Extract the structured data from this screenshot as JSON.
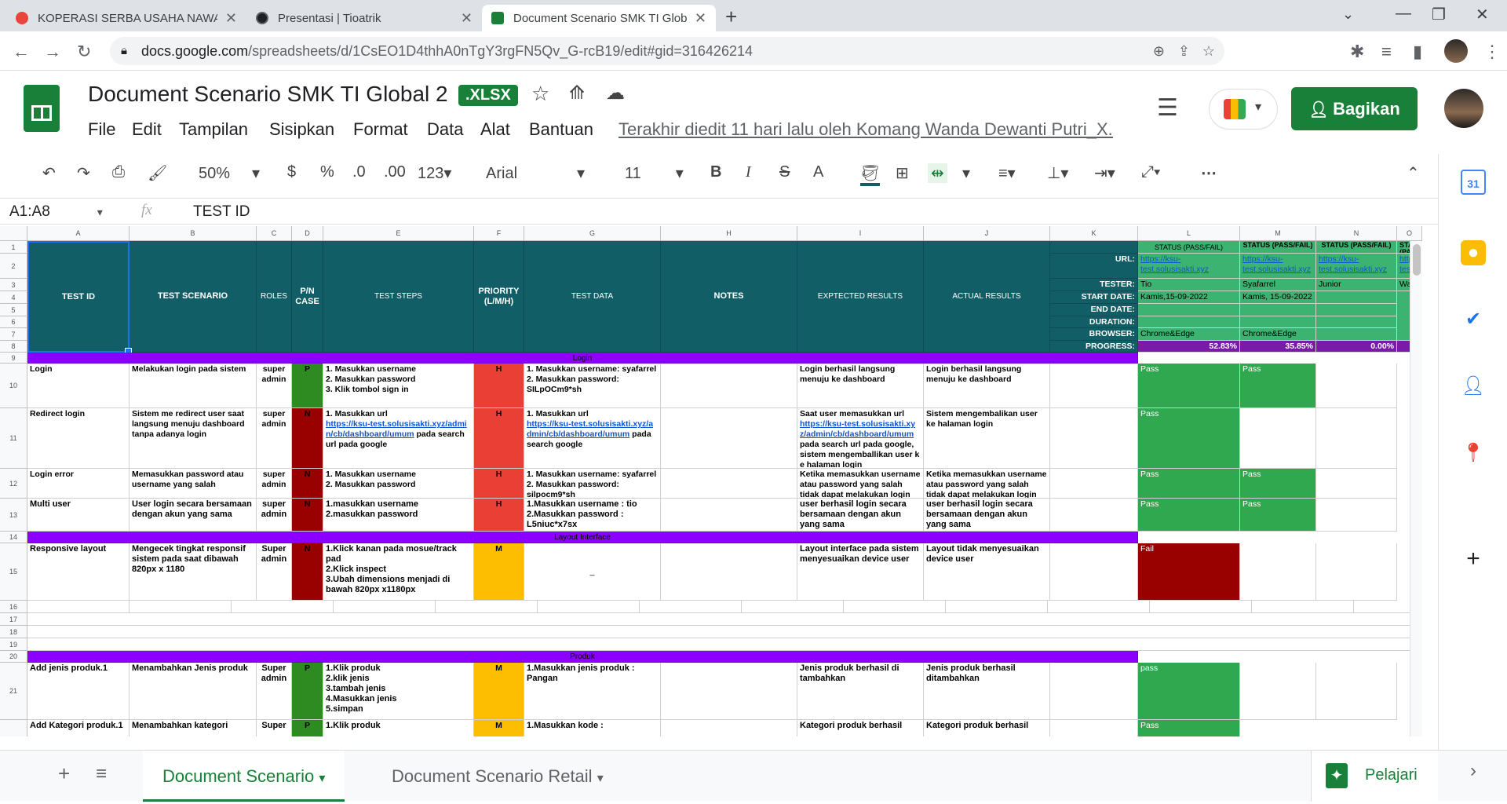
{
  "browser": {
    "tabs": [
      {
        "title": "KOPERASI SERBA USAHA NAWA",
        "fav": "#e8453c"
      },
      {
        "title": "Presentasi | Tioatrik",
        "fav": "#202124"
      },
      {
        "title": "Document Scenario SMK TI Glob",
        "fav": "#188038"
      }
    ],
    "url_host": "docs.google.com",
    "url_path": "/spreadsheets/d/1CsEO1D4thhA0nTgY3rgFN5Qv_G-rcB19/edit#gid=316426214"
  },
  "doc": {
    "title": "Document Scenario SMK TI Global 2",
    "badge": ".XLSX",
    "menu": [
      "File",
      "Edit",
      "Tampilan",
      "Sisipkan",
      "Format",
      "Data",
      "Alat",
      "Bantuan"
    ],
    "last_edit": "Terakhir diedit 11 hari lalu oleh Komang Wanda Dewanti Putri_X...",
    "share": "Bagikan"
  },
  "toolbar": {
    "zoom": "50%",
    "currency": "$",
    "percent": "%",
    "dec_less": ".0",
    "dec_more": ".00",
    "format123": "123",
    "font": "Arial",
    "size": "11",
    "bold": "B",
    "italic": "I",
    "strike": "S",
    "text_color": "A",
    "more": "⋯"
  },
  "formula": {
    "ref": "A1:A8",
    "fx": "fx",
    "value": "TEST ID"
  },
  "columns": [
    "A",
    "B",
    "C",
    "D",
    "E",
    "F",
    "G",
    "H",
    "I",
    "J",
    "K",
    "L",
    "M",
    "N",
    "O"
  ],
  "header": {
    "test_id": "TEST ID",
    "scenario": "TEST SCENARIO",
    "roles": "ROLES",
    "pn": "P/N CASE",
    "steps": "TEST STEPS",
    "priority": "PRIORITY (L/M/H)",
    "data": "TEST DATA",
    "notes": "NOTES",
    "expected": "EXPTECTED RESULTS",
    "actual": "ACTUAL RESULTS"
  },
  "meta_labels": [
    "URL:",
    "TESTER:",
    "START DATE:",
    "END DATE:",
    "DURATION:",
    "BROWSER:",
    "PROGRESS:"
  ],
  "status": [
    {
      "title": "STATUS (PASS/FAIL)",
      "url": "https://ksu-test.solusisakti.xyz",
      "tester": "Tio",
      "start": "Kamis,15-09-2022",
      "browser": "Chrome&Edge",
      "progress": "52.83%"
    },
    {
      "title": "STATUS (PASS/FAIL)",
      "url": "https://ksu-test.solusisakti.xyz",
      "tester": "Syafarrel",
      "start": "Kamis, 15-09-2022",
      "browser": "Chrome&Edge",
      "progress": "35.85%"
    },
    {
      "title": "STATUS (PASS/FAIL)",
      "url": "https://ksu-test.solusisakti.xyz",
      "tester": "Junior",
      "start": "",
      "browser": "",
      "progress": "0.00%"
    },
    {
      "title": "STATUS (PAS",
      "url": "https://ksu-test.solusisakti.xyz",
      "tester": "Wanda",
      "start": "",
      "browser": "",
      "progress": ""
    }
  ],
  "sections": {
    "login": "Login",
    "layout": "Layout Interface",
    "produk": "Produk"
  },
  "rows": [
    {
      "id": "Login",
      "scenario": "Melakukan login pada sistem",
      "role": "super admin",
      "pn": "P",
      "steps": "1. Masukkan username\n2. Masukkan password\n3. Klik tombol sign in",
      "prio": "H",
      "data": "1. Masukkan username: syafarrel\n2. Masukkan password: SILpOCm9*sh",
      "expected": "Login berhasil langsung menuju ke dashboard",
      "actual": "Login berhasil langsung menuju ke dashboard",
      "s1": "Pass",
      "s2": "Pass"
    },
    {
      "id": "Redirect login",
      "scenario": "Sistem me redirect user saat langsung menuju dashboard tanpa adanya login",
      "role": "super admin",
      "pn": "N",
      "steps_a": "1. Masukkan url",
      "steps_link": "https://ksu-test.solusisakti.xyz/admin/cb/dashboard/umum",
      "steps_b": " pada search url pada google",
      "prio": "H",
      "data_a": "1. Masukkan url",
      "data_link": "https://ksu-test.solusisakti.xyz/admin/cb/dashboard/umum",
      "data_b": " pada search google",
      "exp_a": "Saat user memasukkan url",
      "exp_link": "https://ksu-test.solusisakti.xyz/admin/cb/dashboard/umum",
      "exp_b": " pada search url pada google, sistem mengemballikan user ke halaman login",
      "actual": "Sistem mengembalikan user ke halaman login",
      "s1": "Pass",
      "s2": ""
    },
    {
      "id": "Login error",
      "scenario": "Memasukkan password atau username yang salah",
      "role": "super admin",
      "pn": "N",
      "steps": "1. Masukkan username\n2. Masukkan password",
      "prio": "H",
      "data": "1. Masukkan username: syafarrel\n2. Masukkan password: silpocm9*sh",
      "expected": "Ketika memasukkan username atau password yang salah tidak dapat melakukan login",
      "actual": "Ketika memasukkan username atau password yang salah tidak dapat melakukan login",
      "s1": "Pass",
      "s2": "Pass"
    },
    {
      "id": "Multi user",
      "scenario": "User login secara bersamaan dengan akun yang sama",
      "role": "super admin",
      "pn": "N",
      "steps": "1.masukkan username\n2.masukkan password",
      "prio": "H",
      "data": "1.Masukkan username : tio\n2.Masukkan password : L5niuc*x7sx",
      "expected": "user berhasil login secara bersamaan dengan akun yang sama",
      "actual": "user berhasil login secara bersamaan dengan akun yang sama",
      "s1": "Pass",
      "s2": "Pass"
    },
    {
      "id": "Responsive layout",
      "scenario": "Mengecek tingkat responsif sistem pada saat dibawah 820px x 1180",
      "role": "Super admin",
      "pn": "N",
      "steps": "1.Klick kanan pada mosue/track pad\n2.Klick inspect\n3.Ubah dimensions menjadi di bawah 820px x1180px",
      "prio": "M",
      "data": "_",
      "expected": "Layout interface pada sistem menyesuaikan device user",
      "actual": "Layout tidak menyesuaikan device user",
      "s1": "Fail",
      "s2": ""
    },
    {
      "id": "Add jenis produk.1",
      "scenario": "Menambahkan Jenis produk",
      "role": "Super admin",
      "pn": "P",
      "steps": "1.Klik produk\n2.klik jenis\n3.tambah jenis\n4.Masukkan jenis\n5.simpan",
      "prio": "M",
      "data": "1.Masukkan jenis produk : Pangan",
      "expected": "Jenis produk berhasil di tambahkan",
      "actual": "Jenis produk berhasil ditambahkan",
      "s1": "pass",
      "s2": ""
    },
    {
      "id": "Add Kategori produk.1",
      "scenario": "Menambahkan kategori",
      "role": "Super",
      "pn": "P",
      "steps": "1.Klik produk",
      "prio": "M",
      "data": "1.Masukkan kode :",
      "expected": "Kategori produk berhasil",
      "actual": "Kategori produk berhasil",
      "s1": "Pass",
      "s2": ""
    }
  ],
  "row_numbers": [
    "1",
    "2",
    "3",
    "4",
    "5",
    "6",
    "7",
    "8",
    "9",
    "10",
    "11",
    "12",
    "13",
    "14",
    "15",
    "16",
    "17",
    "18",
    "19",
    "20",
    "21"
  ],
  "sheets": {
    "tab1": "Document Scenario",
    "tab2": "Document Scenario Retail",
    "learn": "Pelajari"
  }
}
